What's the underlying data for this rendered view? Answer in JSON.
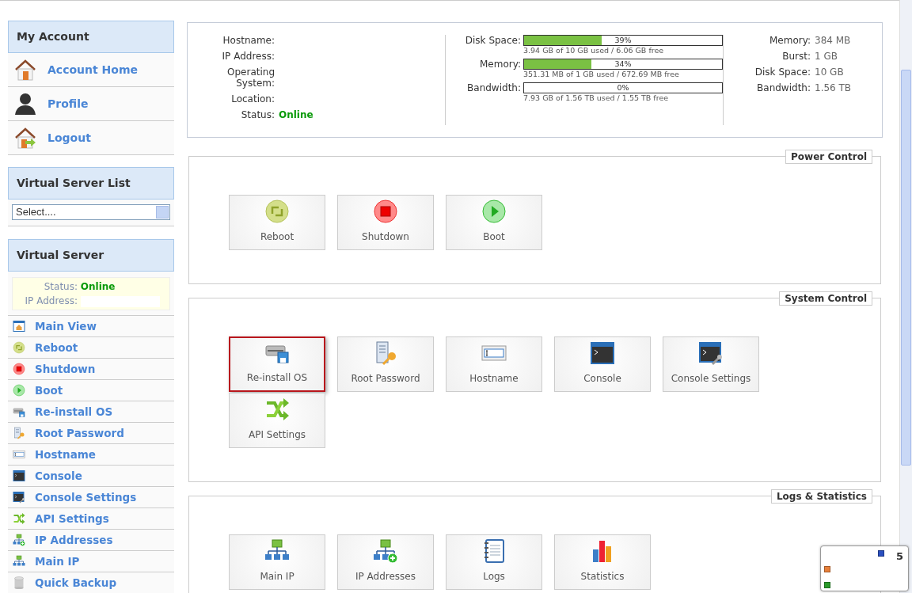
{
  "my_account": {
    "title": "My Account",
    "items": [
      {
        "label": "Account Home",
        "kind": "home"
      },
      {
        "label": "Profile",
        "kind": "user"
      },
      {
        "label": "Logout",
        "kind": "logout"
      }
    ]
  },
  "server_list": {
    "title": "Virtual Server List",
    "select": {
      "value": "Select...."
    }
  },
  "virtual_server": {
    "title": "Virtual Server",
    "status_label": "Status:",
    "status": "Online",
    "ip_label": "IP Address:",
    "items": [
      {
        "label": "Main View",
        "kind": "mainview"
      },
      {
        "label": "Reboot",
        "kind": "reboot"
      },
      {
        "label": "Shutdown",
        "kind": "shutdown"
      },
      {
        "label": "Boot",
        "kind": "boot"
      },
      {
        "label": "Re-install OS",
        "kind": "reinstall"
      },
      {
        "label": "Root Password",
        "kind": "password"
      },
      {
        "label": "Hostname",
        "kind": "hostname"
      },
      {
        "label": "Console",
        "kind": "console"
      },
      {
        "label": "Console Settings",
        "kind": "consolesettings"
      },
      {
        "label": "API Settings",
        "kind": "api"
      },
      {
        "label": "IP Addresses",
        "kind": "ipadd"
      },
      {
        "label": "Main IP",
        "kind": "mainip"
      },
      {
        "label": "Quick Backup",
        "kind": "backup"
      }
    ]
  },
  "info": {
    "fields": [
      {
        "label": "Hostname:"
      },
      {
        "label": "IP Address:"
      },
      {
        "label": "Operating System:"
      },
      {
        "label": "Location:"
      },
      {
        "label": "Status:",
        "value": "Online"
      }
    ],
    "usage": [
      {
        "label": "Disk Space:",
        "level": 0.39,
        "reading": "39%",
        "detail": "3.94 GB of 10 GB used / 6.06 GB free"
      },
      {
        "label": "Memory:",
        "level": 0.34,
        "reading": "34%",
        "detail": "351.31 MB of 1 GB used / 672.69 MB free"
      },
      {
        "label": "Bandwidth:",
        "level": 0,
        "reading": "0%",
        "detail": "7.93 GB of 1.56 TB used / 1.55 TB free"
      }
    ],
    "limits": [
      {
        "label": "Memory:",
        "value": "384 MB"
      },
      {
        "label": "Burst:",
        "value": "1 GB"
      },
      {
        "label": "Disk Space:",
        "value": "10 GB"
      },
      {
        "label": "Bandwidth:",
        "value": "1.56 TB"
      }
    ]
  },
  "sections": [
    {
      "title": "Power Control",
      "tiles": [
        {
          "label": "Reboot",
          "kind": "reboot",
          "selected": false
        },
        {
          "label": "Shutdown",
          "kind": "shutdown",
          "selected": false
        },
        {
          "label": "Boot",
          "kind": "boot",
          "selected": false
        }
      ]
    },
    {
      "title": "System Control",
      "tiles": [
        {
          "label": "Re-install OS",
          "kind": "reinstall",
          "selected": true
        },
        {
          "label": "Root Password",
          "kind": "password",
          "selected": false
        },
        {
          "label": "Hostname",
          "kind": "hostname",
          "selected": false
        },
        {
          "label": "Console",
          "kind": "console",
          "selected": false
        },
        {
          "label": "Console Settings",
          "kind": "consolesettings",
          "selected": false
        },
        {
          "label": "API Settings",
          "kind": "api",
          "selected": false
        }
      ]
    },
    {
      "title": "Logs & Statistics",
      "tiles": [
        {
          "label": "Main IP",
          "kind": "mainip",
          "selected": false
        },
        {
          "label": "IP Addresses",
          "kind": "ipadd",
          "selected": false
        },
        {
          "label": "Logs",
          "kind": "logs",
          "selected": false
        },
        {
          "label": "Statistics",
          "kind": "stats",
          "selected": false
        }
      ]
    }
  ],
  "overlay": {
    "count": "5"
  }
}
